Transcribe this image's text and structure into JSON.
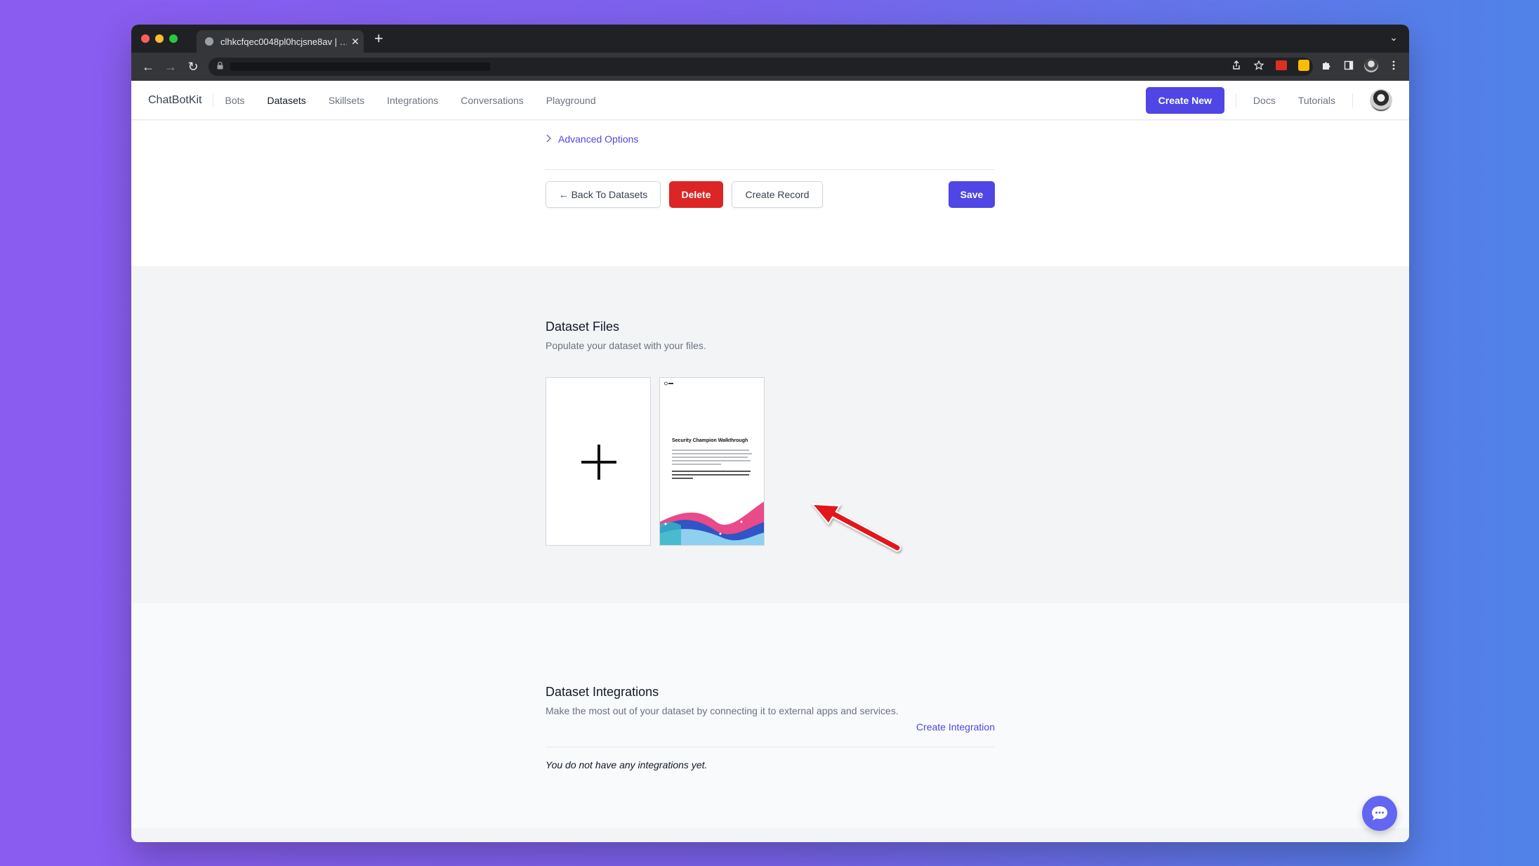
{
  "browser": {
    "tab_title": "clhkcfqec0048pl0hcjsne8av | …",
    "tab_close": "✕",
    "new_tab": "+",
    "tab_menu": "⌄",
    "nav_back": "←",
    "nav_forward": "→",
    "nav_reload": "↻",
    "lock": "🔒"
  },
  "header": {
    "brand": "ChatBotKit",
    "nav": [
      "Bots",
      "Datasets",
      "Skillsets",
      "Integrations",
      "Conversations",
      "Playground"
    ],
    "active_nav": "Datasets",
    "create_new": "Create New",
    "docs": "Docs",
    "tutorials": "Tutorials"
  },
  "dataset_form": {
    "advanced_options": "Advanced Options",
    "back_button": "← Back To Datasets",
    "delete_button": "Delete",
    "create_record_button": "Create Record",
    "save_button": "Save"
  },
  "files_section": {
    "title": "Dataset Files",
    "subtitle": "Populate your dataset with your files.",
    "file_card": {
      "title": "Security Champion Walkthrough"
    }
  },
  "integrations_section": {
    "title": "Dataset Integrations",
    "subtitle": "Make the most out of your dataset by connecting it to external apps and services.",
    "create_link": "Create Integration",
    "empty_message": "You do not have any integrations yet."
  },
  "colors": {
    "accent": "#4f46e5",
    "danger": "#dc2626",
    "annotation_arrow": "#e3141b"
  },
  "icons": {
    "advanced_chevron": "chevron-right-icon",
    "chat": "chat-bubble-icon",
    "add_file": "plus-icon"
  }
}
